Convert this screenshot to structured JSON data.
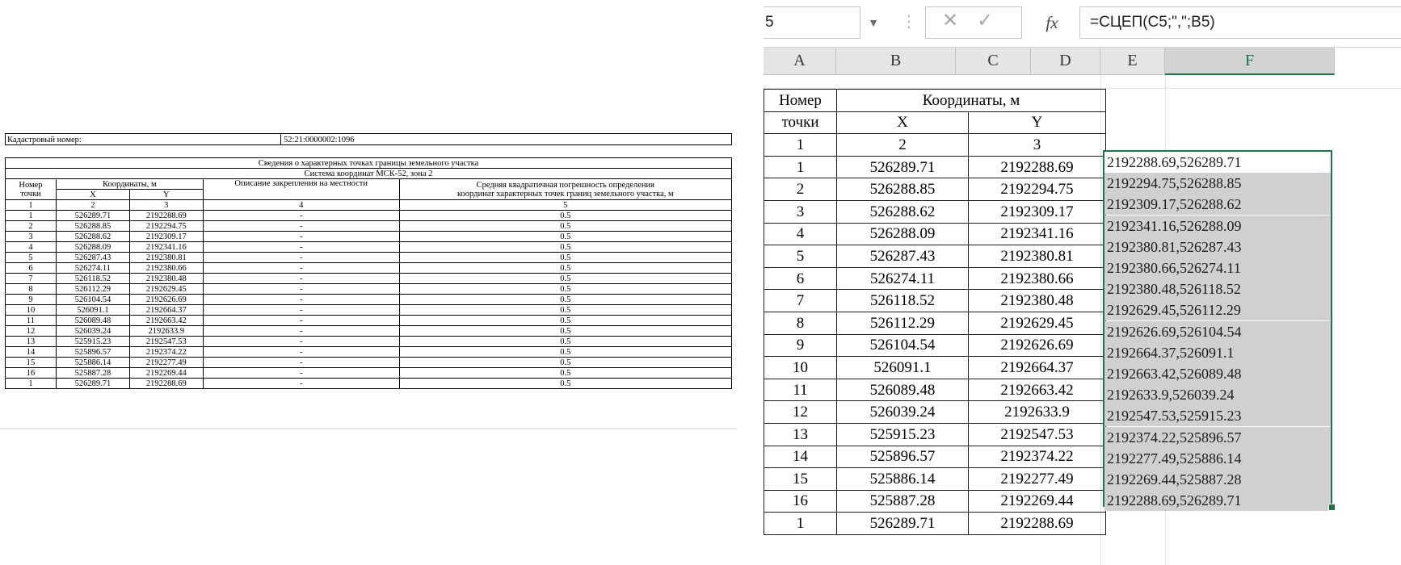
{
  "document": {
    "cadastral_label": "Кадастровый номер:",
    "cadastral_value": "52:21:0000002:1096",
    "title": "Сведения о характерных точках границы земельного участка",
    "system": "Система координат МСК-52, зона 2",
    "headers": {
      "point_no_1": "Номер",
      "point_no_2": "точки",
      "coords": "Координаты, м",
      "x": "X",
      "y": "Y",
      "description": "Описание закрепления на местности",
      "accuracy_1": "Средняя квадратичная погрешность определения",
      "accuracy_2": "координат характерных точек границ земельного участка, м",
      "n1": "1",
      "n2": "2",
      "n3": "3",
      "n4": "4",
      "n5": "5"
    },
    "rows": [
      {
        "n": "1",
        "x": "526289.71",
        "y": "2192288.69",
        "d": "-",
        "a": "0.5"
      },
      {
        "n": "2",
        "x": "526288.85",
        "y": "2192294.75",
        "d": "-",
        "a": "0.5"
      },
      {
        "n": "3",
        "x": "526288.62",
        "y": "2192309.17",
        "d": "-",
        "a": "0.5"
      },
      {
        "n": "4",
        "x": "526288.09",
        "y": "2192341.16",
        "d": "-",
        "a": "0.5"
      },
      {
        "n": "5",
        "x": "526287.43",
        "y": "2192380.81",
        "d": "-",
        "a": "0.5"
      },
      {
        "n": "6",
        "x": "526274.11",
        "y": "2192380.66",
        "d": "-",
        "a": "0.5"
      },
      {
        "n": "7",
        "x": "526118.52",
        "y": "2192380.48",
        "d": "-",
        "a": "0.5"
      },
      {
        "n": "8",
        "x": "526112.29",
        "y": "2192629.45",
        "d": "-",
        "a": "0.5"
      },
      {
        "n": "9",
        "x": "526104.54",
        "y": "2192626.69",
        "d": "-",
        "a": "0.5"
      },
      {
        "n": "10",
        "x": "526091.1",
        "y": "2192664.37",
        "d": "-",
        "a": "0.5"
      },
      {
        "n": "11",
        "x": "526089.48",
        "y": "2192663.42",
        "d": "-",
        "a": "0.5"
      },
      {
        "n": "12",
        "x": "526039.24",
        "y": "2192633.9",
        "d": "-",
        "a": "0.5"
      },
      {
        "n": "13",
        "x": "525915.23",
        "y": "2192547.53",
        "d": "-",
        "a": "0.5"
      },
      {
        "n": "14",
        "x": "525896.57",
        "y": "2192374.22",
        "d": "-",
        "a": "0.5"
      },
      {
        "n": "15",
        "x": "525886.14",
        "y": "2192277.49",
        "d": "-",
        "a": "0.5"
      },
      {
        "n": "16",
        "x": "525887.28",
        "y": "2192269.44",
        "d": "-",
        "a": "0.5"
      },
      {
        "n": "1",
        "x": "526289.71",
        "y": "2192288.69",
        "d": "-",
        "a": "0.5"
      }
    ]
  },
  "excel": {
    "name_box": "5",
    "formula": "=СЦЕП(C5;\",\";B5)",
    "icons": {
      "cancel": "cancel-icon",
      "enter": "enter-icon",
      "fx": "fx-icon",
      "dropdown": "chevron-down-icon"
    },
    "fx_label": "fx",
    "columns": [
      "A",
      "B",
      "C",
      "D",
      "E",
      "F"
    ],
    "headers": {
      "point_no_1": "Номер",
      "point_no_2": "точки",
      "coords": "Координаты, м",
      "x": "X",
      "y": "Y",
      "n1": "1",
      "n2": "2",
      "n3": "3"
    },
    "rows": [
      {
        "n": "1",
        "x": "526289.71",
        "y": "2192288.69",
        "f": "2192288.69,526289.71"
      },
      {
        "n": "2",
        "x": "526288.85",
        "y": "2192294.75",
        "f": "2192294.75,526288.85"
      },
      {
        "n": "3",
        "x": "526288.62",
        "y": "2192309.17",
        "f": "2192309.17,526288.62"
      },
      {
        "n": "4",
        "x": "526288.09",
        "y": "2192341.16",
        "f": "2192341.16,526288.09"
      },
      {
        "n": "5",
        "x": "526287.43",
        "y": "2192380.81",
        "f": "2192380.81,526287.43"
      },
      {
        "n": "6",
        "x": "526274.11",
        "y": "2192380.66",
        "f": "2192380.66,526274.11"
      },
      {
        "n": "7",
        "x": "526118.52",
        "y": "2192380.48",
        "f": "2192380.48,526118.52"
      },
      {
        "n": "8",
        "x": "526112.29",
        "y": "2192629.45",
        "f": "2192629.45,526112.29"
      },
      {
        "n": "9",
        "x": "526104.54",
        "y": "2192626.69",
        "f": "2192626.69,526104.54"
      },
      {
        "n": "10",
        "x": "526091.1",
        "y": "2192664.37",
        "f": "2192664.37,526091.1"
      },
      {
        "n": "11",
        "x": "526089.48",
        "y": "2192663.42",
        "f": "2192663.42,526089.48"
      },
      {
        "n": "12",
        "x": "526039.24",
        "y": "2192633.9",
        "f": "2192633.9,526039.24"
      },
      {
        "n": "13",
        "x": "525915.23",
        "y": "2192547.53",
        "f": "2192547.53,525915.23"
      },
      {
        "n": "14",
        "x": "525896.57",
        "y": "2192374.22",
        "f": "2192374.22,525896.57"
      },
      {
        "n": "15",
        "x": "525886.14",
        "y": "2192277.49",
        "f": "2192277.49,525886.14"
      },
      {
        "n": "16",
        "x": "525887.28",
        "y": "2192269.44",
        "f": "2192269.44,525887.28"
      },
      {
        "n": "1",
        "x": "526289.71",
        "y": "2192288.69",
        "f": "2192288.69,526289.71"
      }
    ],
    "colors": {
      "selection": "#217346",
      "selected_fill": "#d0d0d0",
      "header_bg": "#e5e5e5"
    }
  }
}
